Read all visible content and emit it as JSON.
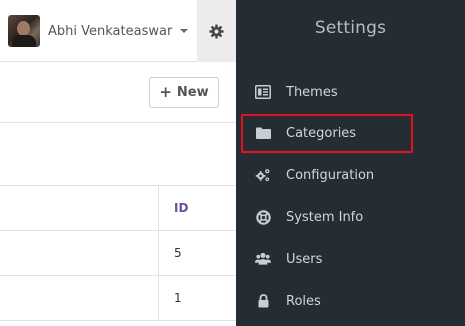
{
  "header": {
    "user_name": "Abhi Venkateaswar"
  },
  "toolbar": {
    "new_button_label": "New"
  },
  "table": {
    "id_header": "ID",
    "rows": [
      {
        "id": "5"
      },
      {
        "id": "1"
      }
    ]
  },
  "settings": {
    "title": "Settings",
    "items": [
      {
        "label": "Themes",
        "icon": "themes-icon"
      },
      {
        "label": "Categories",
        "icon": "folder-icon"
      },
      {
        "label": "Configuration",
        "icon": "cogs-icon"
      },
      {
        "label": "System Info",
        "icon": "life-ring-icon"
      },
      {
        "label": "Users",
        "icon": "users-icon"
      },
      {
        "label": "Roles",
        "icon": "lock-icon"
      }
    ],
    "highlighted_item": "Categories"
  },
  "colors": {
    "panel_background": "#262c33",
    "highlight_border": "#e0141e",
    "id_header_color": "#6b4fa0"
  }
}
